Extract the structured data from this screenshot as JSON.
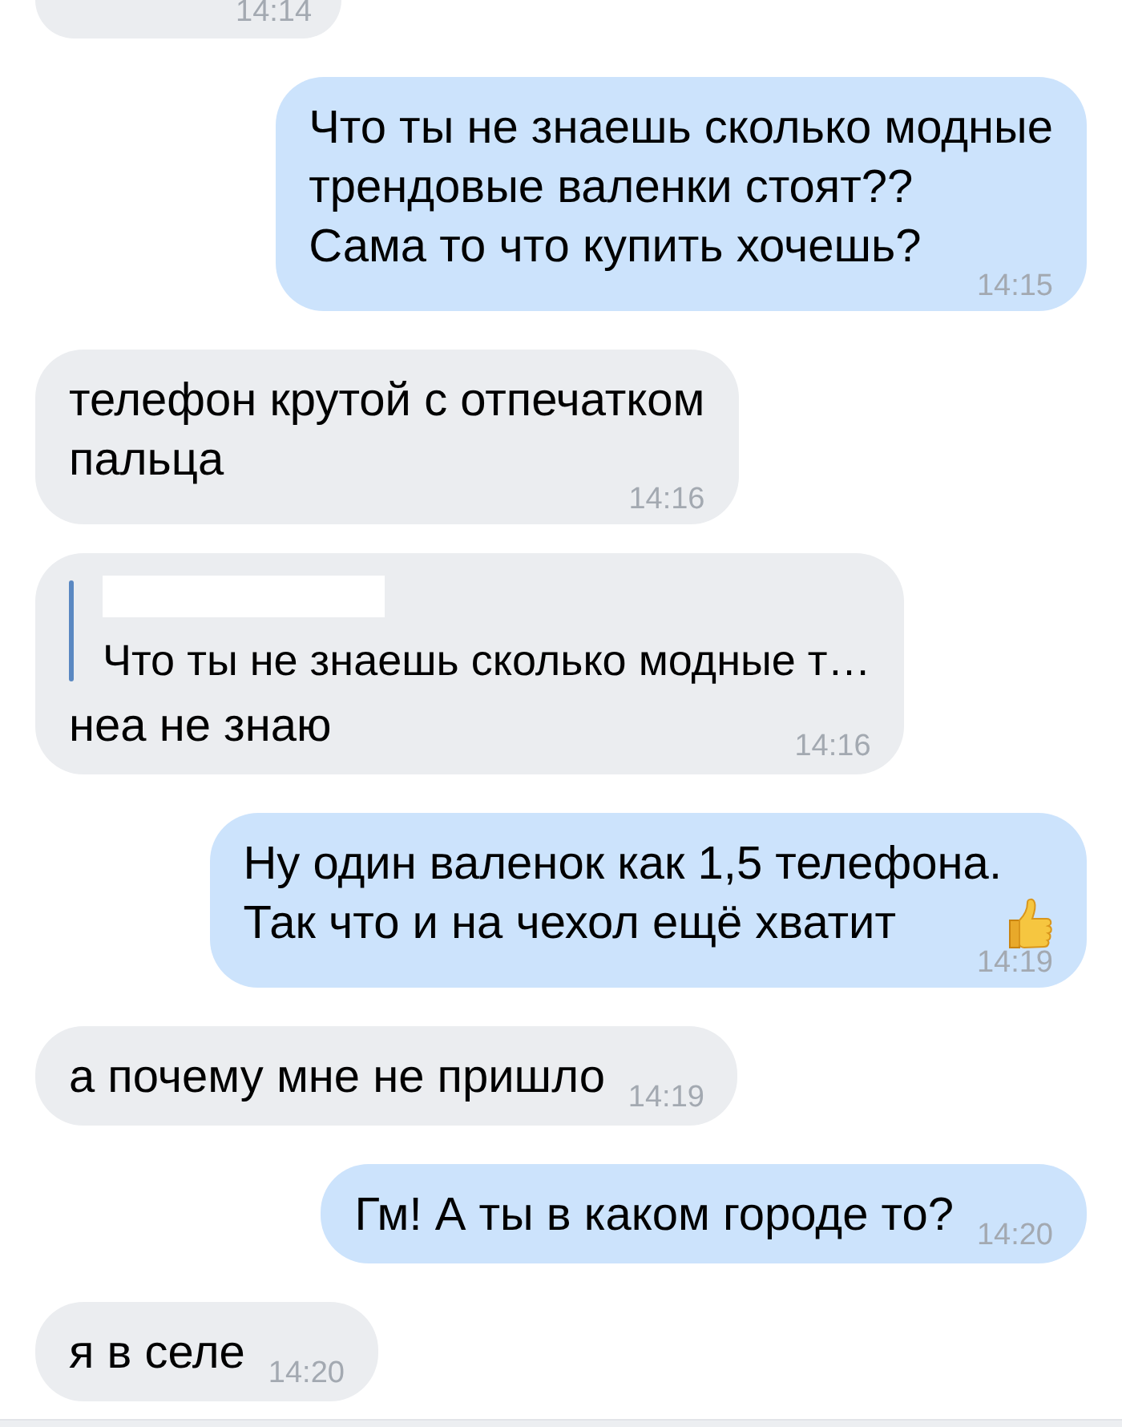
{
  "messages": [
    {
      "outgoing": false,
      "kind": "cut",
      "time": "14:14"
    },
    {
      "outgoing": true,
      "kind": "text",
      "text": "Что ты не знаешь сколько модные\nтрендовые валенки стоят??\nСама то что купить хочешь?",
      "time": "14:15"
    },
    {
      "outgoing": false,
      "kind": "text",
      "text": "телефон крутой с отпечатком\nпальца",
      "time": "14:16"
    },
    {
      "outgoing": false,
      "kind": "reply",
      "quote": "Что ты не знаешь сколько модные т…",
      "text": "неа не знаю",
      "time": "14:16"
    },
    {
      "outgoing": true,
      "kind": "text",
      "text": "Ну один валенок как 1,5 телефона.\nТак что и на чехол ещё хватит",
      "emoji": true,
      "time": "14:19"
    },
    {
      "outgoing": false,
      "kind": "text",
      "text": "а почему мне не пришло",
      "time": "14:19"
    },
    {
      "outgoing": true,
      "kind": "text",
      "text": "Гм! А ты в каком городе то?",
      "time": "14:20"
    },
    {
      "outgoing": false,
      "kind": "text",
      "text": "я в селе",
      "time": "14:20"
    }
  ]
}
